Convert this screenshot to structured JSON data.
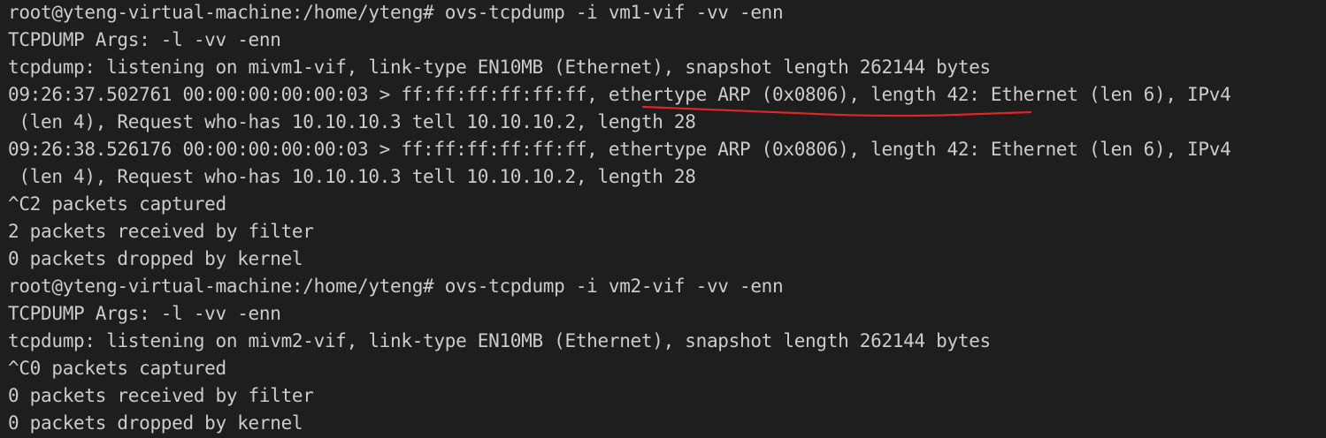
{
  "terminal": {
    "lines": [
      "root@yteng-virtual-machine:/home/yteng# ovs-tcpdump -i vm1-vif -vv -enn",
      "TCPDUMP Args: -l -vv -enn",
      "tcpdump: listening on mivm1-vif, link-type EN10MB (Ethernet), snapshot length 262144 bytes",
      "09:26:37.502761 00:00:00:00:00:03 > ff:ff:ff:ff:ff:ff, ethertype ARP (0x0806), length 42: Ethernet (len 6), IPv4",
      " (len 4), Request who-has 10.10.10.3 tell 10.10.10.2, length 28",
      "09:26:38.526176 00:00:00:00:00:03 > ff:ff:ff:ff:ff:ff, ethertype ARP (0x0806), length 42: Ethernet (len 6), IPv4",
      " (len 4), Request who-has 10.10.10.3 tell 10.10.10.2, length 28",
      "^C2 packets captured",
      "2 packets received by filter",
      "0 packets dropped by kernel",
      "root@yteng-virtual-machine:/home/yteng# ovs-tcpdump -i vm2-vif -vv -enn",
      "TCPDUMP Args: -l -vv -enn",
      "tcpdump: listening on mivm2-vif, link-type EN10MB (Ethernet), snapshot length 262144 bytes",
      "^C0 packets captured",
      "0 packets received by filter",
      "0 packets dropped by kernel"
    ]
  },
  "colors": {
    "background": "#1e1e1e",
    "text": "#cccccc",
    "annotation": "#e0242b"
  }
}
